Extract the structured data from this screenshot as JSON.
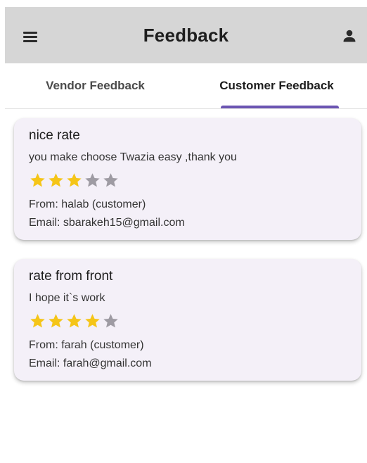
{
  "app_bar": {
    "title": "Feedback",
    "menu_icon": "menu-icon",
    "profile_icon": "person-icon"
  },
  "tabs": [
    {
      "label": "Vendor Feedback",
      "selected": false
    },
    {
      "label": "Customer Feedback",
      "selected": true
    }
  ],
  "colors": {
    "app_bar_bg": "#d6d6d6",
    "tab_indicator": "#6b55b2",
    "card_bg": "#f4f0f8",
    "star_filled": "#f5c518",
    "star_empty": "#9e9ba3"
  },
  "feedback": [
    {
      "title": "nice rate",
      "message": "you make choose Twazia easy ,thank you",
      "rating": 3,
      "max_rating": 5,
      "from": "From: halab (customer)",
      "email": "Email: sbarakeh15@gmail.com"
    },
    {
      "title": "rate from front",
      "message": "I hope it`s work",
      "rating": 4,
      "max_rating": 5,
      "from": "From: farah (customer)",
      "email": "Email: farah@gmail.com"
    }
  ]
}
